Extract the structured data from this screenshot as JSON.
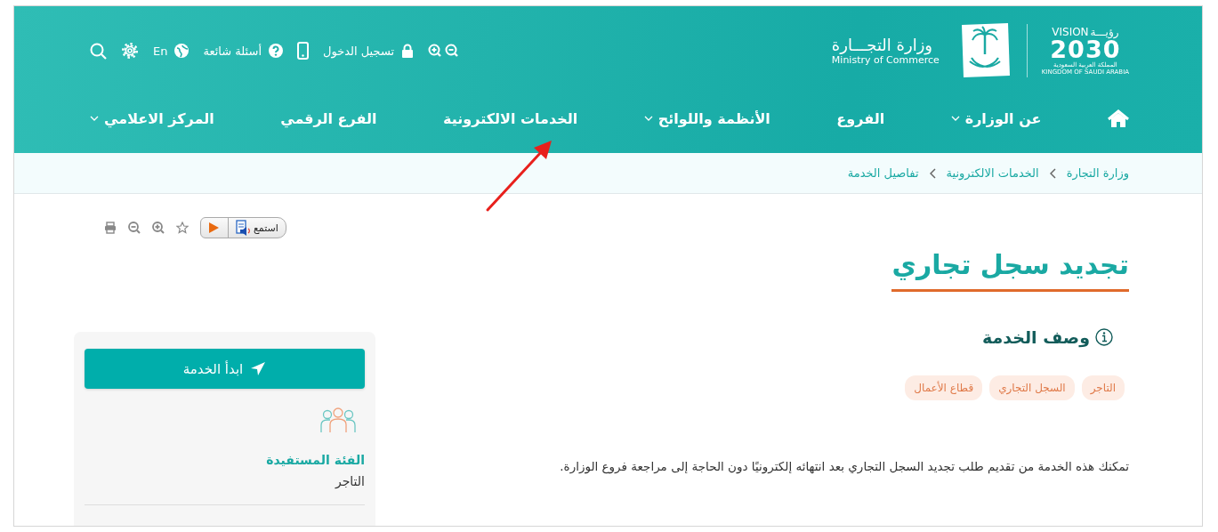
{
  "header": {
    "vision_logo": {
      "word_en": "VISION",
      "word_ar": "رؤيـــة",
      "year": "2030",
      "country_ar": "المملكة العربية السعودية",
      "country_en": "KINGDOM OF SAUDI ARABIA"
    },
    "ministry_logo": {
      "name_ar": "وزارة التجـــارة",
      "name_en": "Ministry of Commerce"
    },
    "utilities": [
      {
        "kind": "zoom"
      },
      {
        "kind": "login",
        "label": "تسجيل الدخول"
      },
      {
        "kind": "mobile"
      },
      {
        "kind": "faq",
        "label": "أسئلة شائعة"
      },
      {
        "kind": "language",
        "label": "En"
      },
      {
        "kind": "settings"
      },
      {
        "kind": "search"
      }
    ]
  },
  "nav": [
    {
      "label": "عن الوزارة",
      "has_dropdown": true
    },
    {
      "label": "الفروع",
      "has_dropdown": false
    },
    {
      "label": "الأنظمة واللوائح",
      "has_dropdown": true
    },
    {
      "label": "الخدمات الالكترونية",
      "has_dropdown": false
    },
    {
      "label": "الفرع الرقمي",
      "has_dropdown": false
    },
    {
      "label": "المركز الاعلامي",
      "has_dropdown": true
    }
  ],
  "breadcrumb": [
    "وزارة التجارة",
    "الخدمات الالكترونية",
    "تفاصيل الخدمة"
  ],
  "listen_button": {
    "label": "استمع"
  },
  "page_title": "تجديد سجل تجاري",
  "section_heading": "وصف الخدمة",
  "tags": [
    "التاجر",
    "السجل التجاري",
    "قطاع الأعمال"
  ],
  "description": "تمكنك هذه الخدمة من تقديم طلب تجديد السجل التجاري بعد انتهائه إلكترونيًا دون الحاجة إلى مراجعة فروع الوزارة.",
  "sidebar": {
    "start_button": "ابدأ الخدمة",
    "beneficiary": {
      "heading": "الفئة المستفيدة",
      "value": "التاجر"
    }
  }
}
